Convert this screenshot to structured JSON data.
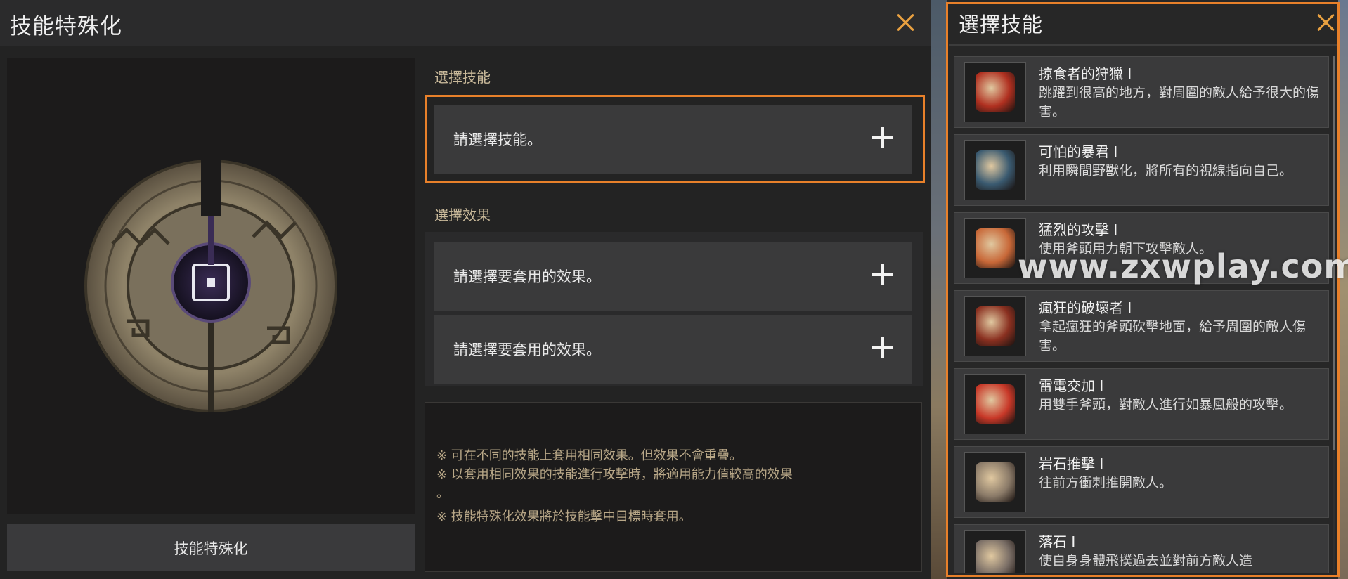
{
  "main_window": {
    "title": "技能特殊化",
    "close_icon": "close-icon",
    "select_skill_label": "選擇技能",
    "skill_slot_text": "請選擇技能。",
    "select_effect_label": "選擇效果",
    "effect_slots": [
      "請選擇要套用的效果。",
      "請選擇要套用的效果。"
    ],
    "notes": [
      "※ 可在不同的技能上套用相同效果。但效果不會重疊。",
      "※ 以套用相同效果的技能進行攻擊時，將適用能力值較高的效果",
      "。",
      "※ 技能特殊化效果將於技能擊中目標時套用。"
    ],
    "action_button": "技能特殊化",
    "accent_color": "#e8802a"
  },
  "skill_picker": {
    "title": "選擇技能",
    "close_icon": "close-icon",
    "skills": [
      {
        "name": "掠食者的狩獵 I",
        "desc": "跳躍到很高的地方，對周圍的敵人給予很大的傷害。",
        "icon": "predator-hunt-icon",
        "color": "#b03020"
      },
      {
        "name": "可怕的暴君 I",
        "desc": "利用瞬間野獸化，將所有的視線指向自己。",
        "icon": "tyrant-icon",
        "color": "#3a5a70"
      },
      {
        "name": "猛烈的攻擊 I",
        "desc": "使用斧頭用力朝下攻擊敵人。",
        "icon": "fierce-attack-icon",
        "color": "#c86838"
      },
      {
        "name": "瘋狂的破壞者 I",
        "desc": "拿起瘋狂的斧頭砍擊地面，給予周圍的敵人傷害。",
        "icon": "mad-destroyer-icon",
        "color": "#8a3020"
      },
      {
        "name": "雷電交加 I",
        "desc": "用雙手斧頭，對敵人進行如暴風般的攻擊。",
        "icon": "thunder-icon",
        "color": "#c83828"
      },
      {
        "name": "岩石推擊 I",
        "desc": "往前方衝刺推開敵人。",
        "icon": "rock-push-icon",
        "color": "#8a7a68"
      },
      {
        "name": "落石 I",
        "desc": "使自身身體飛撲過去並對前方敵人造",
        "icon": "falling-rock-icon",
        "color": "#7a6e66"
      }
    ]
  },
  "watermark": "www.zxwplay.com"
}
